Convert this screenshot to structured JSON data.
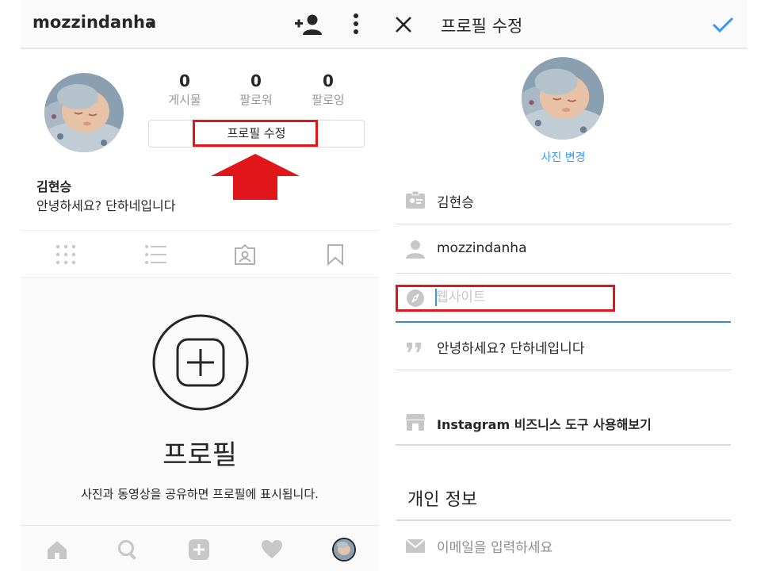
{
  "left_screen": {
    "header": {
      "username": "mozzindanha",
      "icons": [
        "add-user-icon",
        "more-vertical-icon",
        "chevron-down-icon"
      ]
    },
    "profile": {
      "stats": [
        {
          "count": "0",
          "label": "게시물"
        },
        {
          "count": "0",
          "label": "팔로워"
        },
        {
          "count": "0",
          "label": "팔로잉"
        }
      ],
      "edit_profile_button": "프로필 수정",
      "full_name": "김현승",
      "bio": "안녕하세요? 단하네입니다"
    },
    "tabs": [
      "grid-icon",
      "list-icon",
      "tagged-icon",
      "bookmark-icon"
    ],
    "empty_state": {
      "title": "프로필",
      "subtitle": "사진과 동영상을 공유하면 프로필에 표시됩니다."
    },
    "bottom_nav": [
      "home-icon",
      "search-icon",
      "new-post-icon",
      "activity-heart-icon",
      "profile-avatar"
    ],
    "annotation_color": "#e0161b"
  },
  "right_screen": {
    "header": {
      "title": "프로필 수정",
      "icons": [
        "close-icon",
        "checkmark-icon"
      ]
    },
    "change_photo": "사진 변경",
    "fields": {
      "name": "김현승",
      "username": "mozzindanha",
      "website_placeholder": "웹사이트",
      "bio": "안녕하세요? 단하네입니다"
    },
    "business_tools": "Instagram 비즈니스 도구 사용해보기",
    "private_info": {
      "title": "개인 정보",
      "email_placeholder": "이메일을 입력하세요"
    },
    "accent_color": "#3897f0"
  }
}
